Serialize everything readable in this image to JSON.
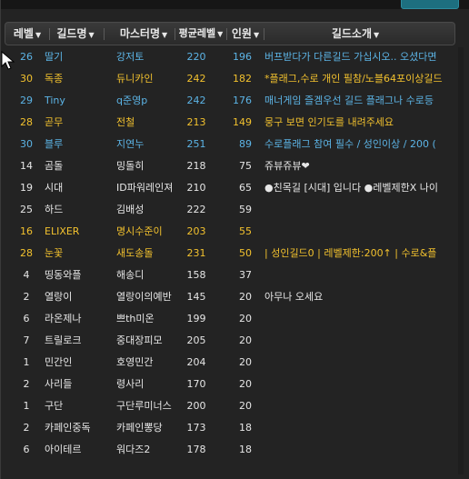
{
  "header": {
    "level": "레벨",
    "guild_name": "길드명",
    "master_name": "마스터명",
    "avg_level": "평균레벨",
    "members": "인원",
    "intro": "길드소개"
  },
  "rows": [
    {
      "level": "26",
      "name": "딸기",
      "master": "강저토",
      "avg": "220",
      "count": "196",
      "intro": "버프받다가 다른길드 가십시오.. 오셨다면",
      "style": "bl"
    },
    {
      "level": "30",
      "name": "독종",
      "master": "듀니카인",
      "avg": "242",
      "count": "182",
      "intro": "*플래그,수로 개인 필참/노블64포이상길드",
      "style": "hl"
    },
    {
      "level": "29",
      "name": "Tiny",
      "master": "q준영p",
      "avg": "242",
      "count": "176",
      "intro": "매너게임 즐겜우선 길드 플래그나 수로등",
      "style": "bl"
    },
    {
      "level": "28",
      "name": "곧무",
      "master": "전철",
      "avg": "213",
      "count": "149",
      "intro": "뭉구 보면 인기도를 내려주세요",
      "style": "hl"
    },
    {
      "level": "30",
      "name": "블루",
      "master": "지연누",
      "avg": "251",
      "count": "89",
      "intro": "수로플래그 참여 필수 / 성인이상 / 200 (",
      "style": "bl"
    },
    {
      "level": "14",
      "name": "곰돌",
      "master": "밍돌히",
      "avg": "218",
      "count": "75",
      "intro": "쥬뷰쥬뷰❤",
      "style": "wh"
    },
    {
      "level": "19",
      "name": "시대",
      "master": "ID파워레인져",
      "avg": "210",
      "count": "65",
      "intro": "●친목길 [시대] 입니다 ●레벨제한X 나이",
      "style": "wh"
    },
    {
      "level": "25",
      "name": "하드",
      "master": "김배성",
      "avg": "222",
      "count": "59",
      "intro": "",
      "style": "wh"
    },
    {
      "level": "16",
      "name": "ELIXER",
      "master": "명시수준이",
      "avg": "203",
      "count": "55",
      "intro": "",
      "style": "hl"
    },
    {
      "level": "28",
      "name": "눈꽃",
      "master": "새도송돌",
      "avg": "231",
      "count": "50",
      "intro": "| 성인길드0 | 레벨제한:200↑ | 수로&플",
      "style": "hl"
    },
    {
      "level": "4",
      "name": "띵동와플",
      "master": "해송디",
      "avg": "158",
      "count": "37",
      "intro": "",
      "style": "wh"
    },
    {
      "level": "2",
      "name": "열랑이",
      "master": "열랑이의예반",
      "avg": "145",
      "count": "20",
      "intro": "아무나 오세요",
      "style": "wh"
    },
    {
      "level": "6",
      "name": "라온제나",
      "master": "쁘th미온",
      "avg": "199",
      "count": "20",
      "intro": "",
      "style": "wh"
    },
    {
      "level": "7",
      "name": "트릴로크",
      "master": "중대장피모",
      "avg": "205",
      "count": "20",
      "intro": "",
      "style": "wh"
    },
    {
      "level": "1",
      "name": "민간인",
      "master": "호영민간",
      "avg": "204",
      "count": "20",
      "intro": "",
      "style": "wh"
    },
    {
      "level": "2",
      "name": "사리들",
      "master": "령사리",
      "avg": "170",
      "count": "20",
      "intro": "",
      "style": "wh"
    },
    {
      "level": "1",
      "name": "구단",
      "master": "구단루미너스",
      "avg": "200",
      "count": "20",
      "intro": "",
      "style": "wh"
    },
    {
      "level": "2",
      "name": "카페인중독",
      "master": "카페인뽕당",
      "avg": "173",
      "count": "18",
      "intro": "",
      "style": "wh"
    },
    {
      "level": "6",
      "name": "아이테르",
      "master": "워다즈2",
      "avg": "178",
      "count": "18",
      "intro": "",
      "style": "wh"
    }
  ]
}
